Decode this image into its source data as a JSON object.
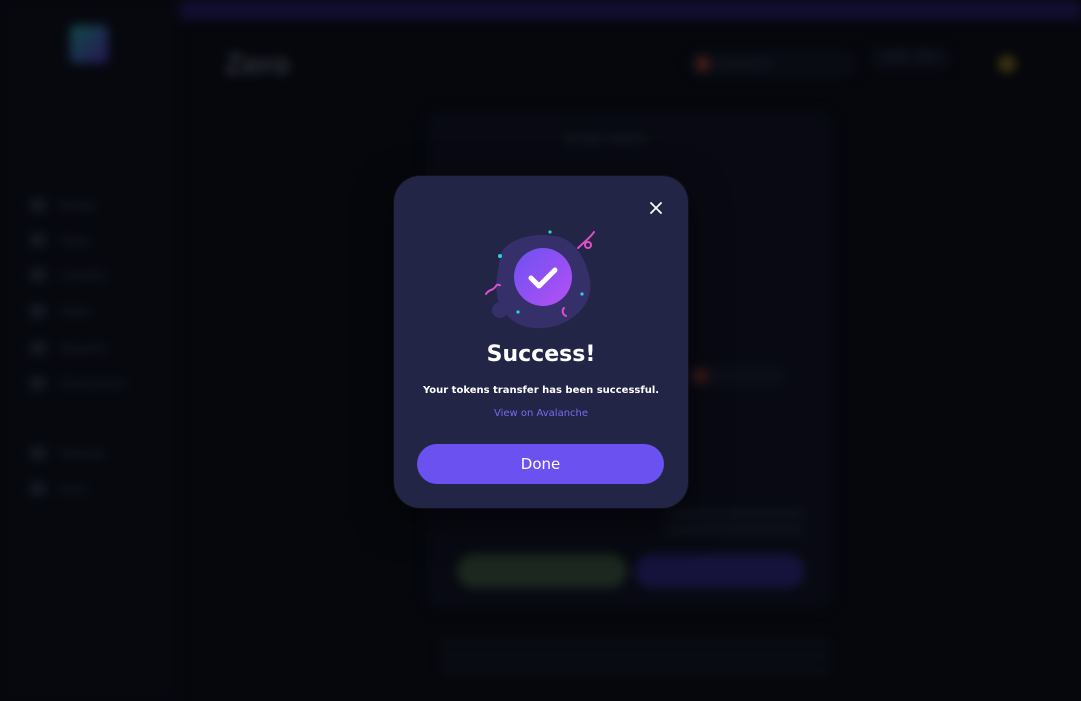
{
  "background": {
    "brand": "Zero",
    "nav_items": [
      "Bridge",
      "Swap",
      "Liquidity",
      "Stake",
      "Rewards",
      "Governance",
      "Settings",
      "Docs"
    ],
    "bridge_title": "Bridge tokens",
    "chain_label": "Avalanche",
    "wallet_label": "0x89...3f2a"
  },
  "modal": {
    "title": "Success!",
    "message": "Your tokens transfer has been successful.",
    "link_label": "View on Avalanche",
    "done_label": "Done",
    "close_icon": "close-icon",
    "illustration_icon": "success-check-icon"
  },
  "colors": {
    "modal_bg": "#232547",
    "accent": "#6b52f0",
    "link": "#7b68f2",
    "check_gradient_start": "#6b52f0",
    "check_gradient_end": "#b64ff5",
    "confetti_pink": "#e04fc8",
    "confetti_cyan": "#2ad4d8"
  }
}
